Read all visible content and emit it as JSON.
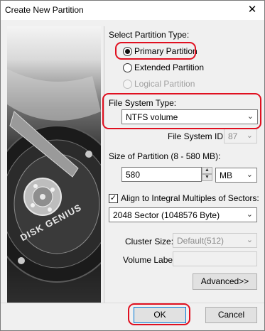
{
  "window": {
    "title": "Create New Partition",
    "close_glyph": "✕"
  },
  "side_image": {
    "brand_text": "DISK GENIUS"
  },
  "partition_type": {
    "heading": "Select Partition Type:",
    "options": [
      {
        "label": "Primary Partition",
        "checked": true,
        "disabled": false
      },
      {
        "label": "Extended Partition",
        "checked": false,
        "disabled": false
      },
      {
        "label": "Logical Partition",
        "checked": false,
        "disabled": true
      }
    ]
  },
  "file_system": {
    "heading": "File System Type:",
    "value": "NTFS volume",
    "id_label": "File System ID:",
    "id_value": "87"
  },
  "size": {
    "heading": "Size of Partition (8 - 580 MB):",
    "value": "580",
    "unit": "MB"
  },
  "align": {
    "label": "Align to Integral Multiples of Sectors:",
    "checked": true,
    "check_glyph": "✓",
    "value": "2048 Sector (1048576 Byte)"
  },
  "cluster": {
    "label": "Cluster Size:",
    "value": "Default(512)"
  },
  "volume": {
    "label": "Volume Label:",
    "value": ""
  },
  "buttons": {
    "advanced": "Advanced>>",
    "ok": "OK",
    "cancel": "Cancel"
  },
  "icons": {
    "dropdown_arrow": "chevron-down-icon",
    "spin_up": "▲",
    "spin_down": "▼"
  },
  "colors": {
    "highlight": "#e01020",
    "default_button_border": "#0078d7"
  }
}
